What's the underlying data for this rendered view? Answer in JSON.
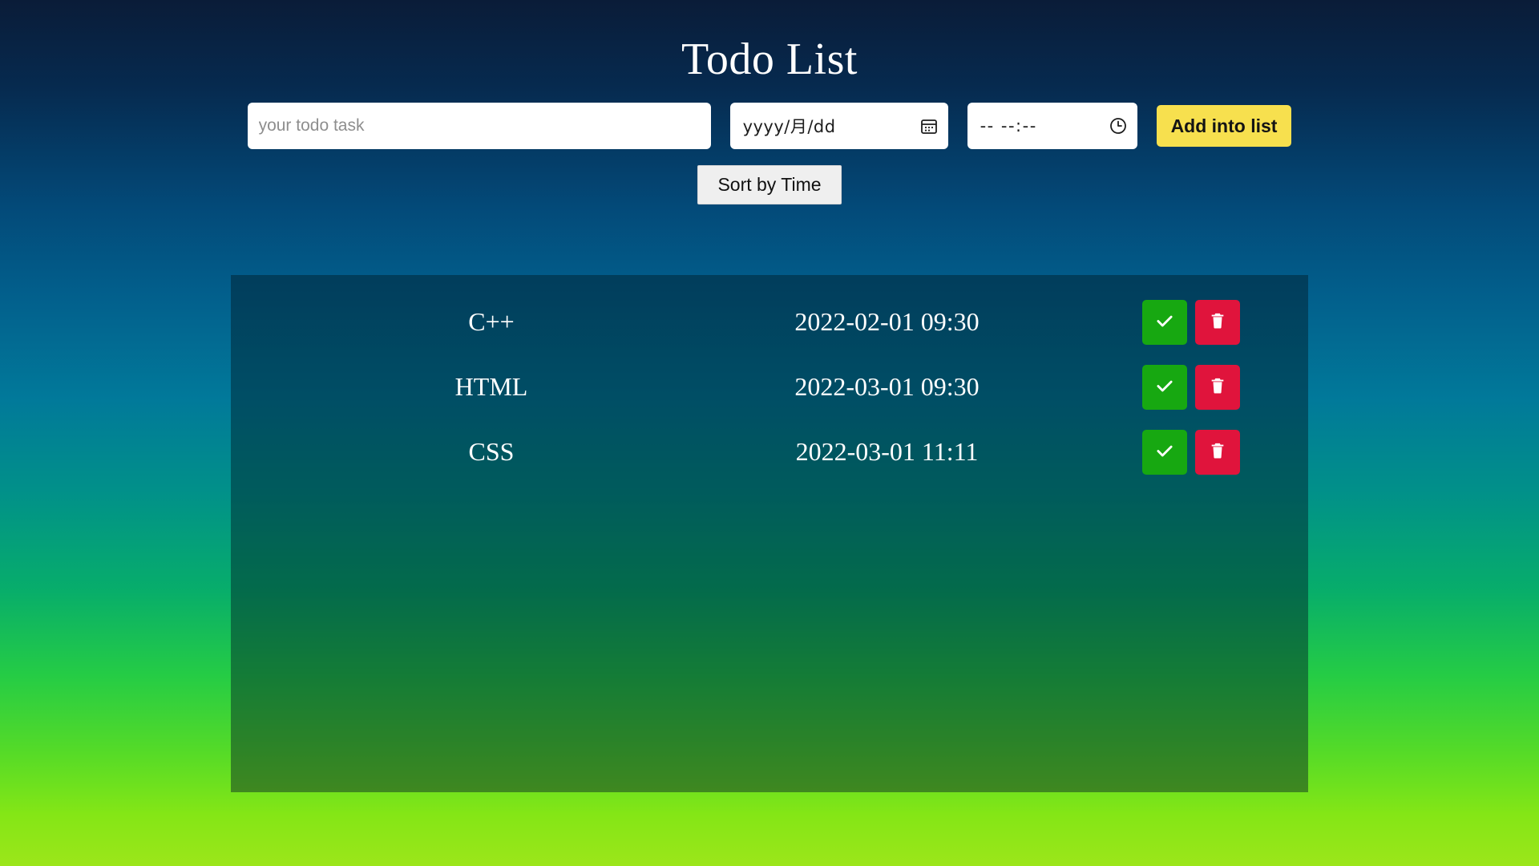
{
  "header": {
    "title": "Todo List"
  },
  "form": {
    "task_input": {
      "value": "",
      "placeholder": "your todo task"
    },
    "date_input": {
      "display": "yyyy/月/dd",
      "icon": "calendar-icon"
    },
    "time_input": {
      "display": "--  --:--",
      "icon": "clock-icon"
    },
    "add_button": {
      "label": "Add into list",
      "color": "#f7e04e"
    }
  },
  "controls": {
    "sort_button": {
      "label": "Sort by Time"
    }
  },
  "list": {
    "columns": [
      "task",
      "time",
      "actions"
    ],
    "done_icon": "check-icon",
    "delete_icon": "trash-icon",
    "done_color": "#17a811",
    "delete_color": "#e0143c",
    "items": [
      {
        "task": "C++",
        "time": "2022-02-01 09:30"
      },
      {
        "task": "HTML",
        "time": "2022-03-01 09:30"
      },
      {
        "task": "CSS",
        "time": "2022-03-01 11:11"
      }
    ]
  },
  "theme": {
    "background_top": "#0a1c38",
    "background_mid": "#019189",
    "background_bottom": "#9ce61a",
    "card_overlay": "rgba(0,26,38,0.45)"
  }
}
